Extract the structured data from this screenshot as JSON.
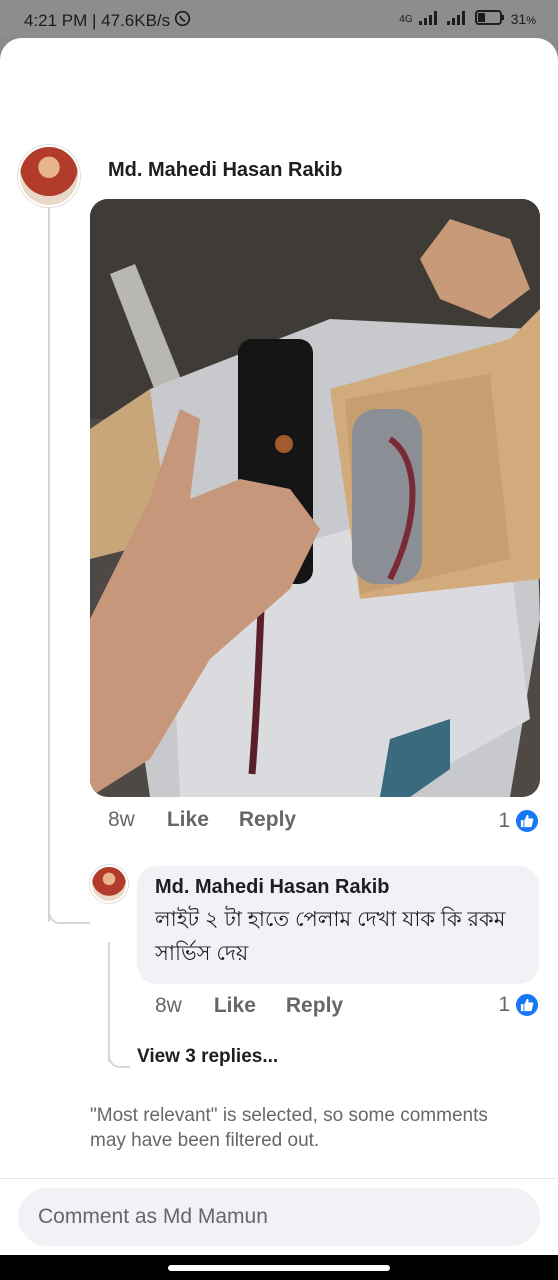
{
  "status_bar": {
    "time_speed": "4:21 PM | 47.6KB/s",
    "network": "4G",
    "battery": "31",
    "battery_unit": "%"
  },
  "comment": {
    "author": "Md. Mahedi Hasan Rakib",
    "time": "8w",
    "like_label": "Like",
    "reply_label": "Reply",
    "reaction_count": "1"
  },
  "reply": {
    "author": "Md. Mahedi Hasan Rakib",
    "text": "লাইট ২ টা হাতে পেলাম দেখা যাক কি রকম সার্ভিস দেয়",
    "time": "8w",
    "like_label": "Like",
    "reply_label": "Reply",
    "reaction_count": "1"
  },
  "view_replies_label": "View 3 replies...",
  "filter_note": "\"Most relevant\" is selected, so some comments may have been filtered out.",
  "comment_input": {
    "placeholder": "Comment as Md Mamun",
    "value": ""
  },
  "icons": {
    "like_reaction": "like-thumb-icon",
    "whatsapp": "whatsapp-icon",
    "signal": "signal-icon",
    "battery": "battery-icon"
  },
  "colors": {
    "facebook_blue": "#1877f2",
    "secondary_text": "#65676b",
    "bubble_bg": "#f0f2f5"
  }
}
